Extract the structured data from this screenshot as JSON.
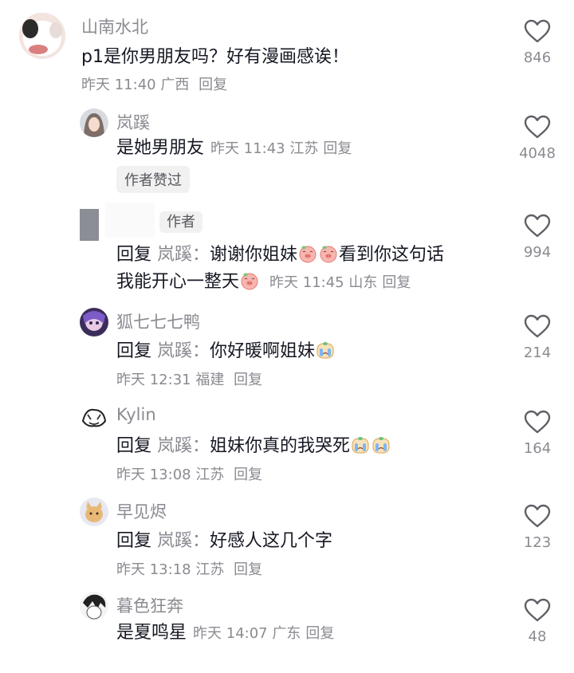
{
  "comments": [
    {
      "name": "山南水北",
      "text": "p1是你男朋友吗？好有漫画感诶！",
      "time": "昨天 11:40",
      "location": "广西",
      "reply": "回复",
      "likes": "846"
    },
    {
      "name": "岚蹊",
      "text": "是她男朋友",
      "time": "昨天 11:43",
      "location": "江苏",
      "reply": "回复",
      "likes": "4048",
      "badge": "作者赞过"
    },
    {
      "name": "",
      "author_badge": "作者",
      "reply_prefix": "回复",
      "reply_target": "岚蹊：",
      "text_line1": "谢谢你姐妹",
      "text_line1b": "看到你这句话",
      "text_line2": "我能开心一整天",
      "time": "昨天 11:45",
      "location": "山东",
      "reply": "回复",
      "likes": "994",
      "emojis": [
        "shy-pig-emoji",
        "shy-pig-emoji",
        "shy-pig-emoji"
      ]
    },
    {
      "name": "狐七七七鸭",
      "reply_prefix": "回复",
      "reply_target": "岚蹊：",
      "text": "你好暖啊姐妹",
      "time": "昨天 12:31",
      "location": "福建",
      "reply": "回复",
      "likes": "214",
      "emojis": [
        "crying-emoji"
      ]
    },
    {
      "name": "Kylin",
      "reply_prefix": "回复",
      "reply_target": "岚蹊：",
      "text": "姐妹你真的我哭死",
      "time": "昨天 13:08",
      "location": "江苏",
      "reply": "回复",
      "likes": "164",
      "emojis": [
        "crying-emoji",
        "crying-emoji"
      ]
    },
    {
      "name": "早见烬",
      "reply_prefix": "回复",
      "reply_target": "岚蹊：",
      "text": "好感人这几个字",
      "time": "昨天 13:18",
      "location": "江苏",
      "reply": "回复",
      "likes": "123"
    },
    {
      "name": "暮色狂奔",
      "text": "是夏鸣星",
      "time": "昨天 14:07",
      "location": "广东",
      "reply": "回复",
      "likes": "48"
    }
  ],
  "colors": {
    "primary_text": "#161823",
    "secondary_text": "#8a8b91",
    "badge_bg": "#f1f1f2"
  },
  "icons": {
    "like": "heart-outline-icon"
  }
}
